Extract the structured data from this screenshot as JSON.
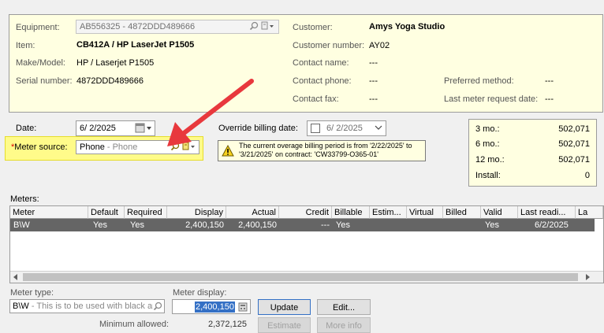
{
  "equipment_panel": {
    "equipment_label": "Equipment:",
    "equipment_value": "AB556325 - 4872DDD489666",
    "item_label": "Item:",
    "item_value": "CB412A / HP LaserJet P1505",
    "make_label": "Make/Model:",
    "make_value": "HP / Laserjet P1505",
    "serial_label": "Serial number:",
    "serial_value": "4872DDD489666",
    "customer_label": "Customer:",
    "customer_value": "Amys Yoga Studio",
    "custnum_label": "Customer number:",
    "custnum_value": "AY02",
    "contact_label": "Contact name:",
    "contact_value": "---",
    "phone_label": "Contact phone:",
    "phone_value": "---",
    "fax_label": "Contact fax:",
    "fax_value": "---",
    "pref_label": "Preferred method:",
    "pref_value": "---",
    "lastreq_label": "Last meter request date:",
    "lastreq_value": "---"
  },
  "form": {
    "date_label": "Date:",
    "date_value": "6/ 2/2025",
    "override_label": "Override billing date:",
    "override_value": "6/ 2/2025",
    "meter_source_star": "*",
    "meter_source_label": "Meter source:",
    "meter_source_value": "Phone",
    "meter_source_hint": " - Phone",
    "warning_line1": "The current overage billing period is from '2/22/2025' to",
    "warning_line2": "'3/21/2025' on contract: 'CW33799-O365-01'"
  },
  "stats": [
    {
      "label": "3 mo.:",
      "value": "502,071"
    },
    {
      "label": "6 mo.:",
      "value": "502,071"
    },
    {
      "label": "12 mo.:",
      "value": "502,071"
    },
    {
      "label": "Install:",
      "value": "0"
    }
  ],
  "meters": {
    "title": "Meters:",
    "columns": [
      "Meter",
      "Default",
      "Required",
      "Display",
      "Actual",
      "Credit",
      "Billable",
      "Estim...",
      "Virtual",
      "Billed",
      "Valid",
      "Last readi...",
      "La"
    ],
    "row": {
      "meter": "B\\W",
      "default": "Yes",
      "required": "Yes",
      "display": "2,400,150",
      "actual": "2,400,150",
      "credit": "---",
      "billable": "Yes",
      "valid": "Yes",
      "last_reading": "6/2/2025"
    }
  },
  "bottom": {
    "meter_type_label": "Meter type:",
    "meter_type_value": "B\\W",
    "meter_type_hint": " - This is to be used with black an",
    "meter_display_label": "Meter display:",
    "meter_display_value": "2,400,150",
    "min_allowed_label": "Minimum allowed:",
    "min_allowed_value": "2,372,125",
    "update_btn": "Update",
    "edit_btn": "Edit...",
    "estimate_btn": "Estimate",
    "moreinfo_btn": "More info"
  },
  "colors": {
    "info_bg": "#ffffe1",
    "highlight": "#fffb8a",
    "arrow": "#e8383d",
    "selection": "#3470c5"
  }
}
